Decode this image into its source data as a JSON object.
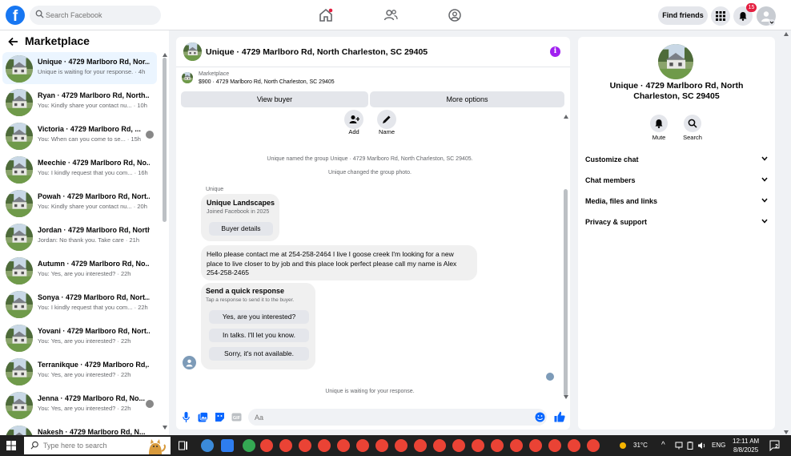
{
  "search": {
    "placeholder": "Search Facebook"
  },
  "topnav": {
    "find_friends": "Find friends",
    "notifications_count": "15"
  },
  "sidebar": {
    "title": "Marketplace",
    "conversations": [
      {
        "name": "Unique · 4729 Marlboro Rd, Nor...",
        "snippet": "Unique is waiting for your response. · 4h"
      },
      {
        "name": "Ryan · 4729 Marlboro Rd, North...",
        "snippet": "You: Kindly share your contact nu... · 10h"
      },
      {
        "name": "Victoria · 4729 Marlboro Rd, ...",
        "snippet": "You: When can you come to se... · 15h"
      },
      {
        "name": "Meechie · 4729 Marlboro Rd, No...",
        "snippet": "You: I kindly request that you com... · 16h"
      },
      {
        "name": "Powah · 4729 Marlboro Rd, Nort...",
        "snippet": "You: Kindly share your contact nu... · 20h"
      },
      {
        "name": "Jordan · 4729 Marlboro Rd, North...",
        "snippet": "Jordan: No thank you. Take care · 21h"
      },
      {
        "name": "Autumn · 4729 Marlboro Rd, No...",
        "snippet": "You: Yes, are you interested? · 22h"
      },
      {
        "name": "Sonya · 4729 Marlboro Rd, Nort...",
        "snippet": "You: I kindly request that you com... · 22h"
      },
      {
        "name": "Yovani · 4729 Marlboro Rd, Nort...",
        "snippet": "You: Yes, are you interested? · 22h"
      },
      {
        "name": "Terranikque · 4729 Marlboro Rd,...",
        "snippet": "You: Yes, are you interested? · 22h"
      },
      {
        "name": "Jenna · 4729 Marlboro Rd, No...",
        "snippet": "You: Yes, are you interested? · 22h"
      },
      {
        "name": "Nakesh · 4729 Marlboro Rd, N...",
        "snippet": ""
      }
    ]
  },
  "chat": {
    "title": "Unique · 4729 Marlboro Rd, North Charleston, SC 29405",
    "marketplace_label": "Marketplace",
    "listing": "$900 · 4729 Marlboro Rd, North Charleston, SC 29405",
    "view_buyer": "View buyer",
    "more_options": "More options",
    "add_label": "Add",
    "name_label": "Name",
    "sys1": "Unique named the group Unique · 4729 Marlboro Rd, North Charleston, SC 29405.",
    "sys2": "Unique changed the group photo.",
    "sender": "Unique",
    "card_title": "Unique Landscapes",
    "card_sub": "Joined Facebook in 2025",
    "buyer_details": "Buyer details",
    "message": "Hello please contact me at 254-258-2464 I live I goose creek I'm looking for a new place to live closer to by job and this place look perfect please call my name is Alex 254-258-2465",
    "quick_title": "Send a quick response",
    "quick_sub": "Tap a response to send it to the buyer.",
    "quick_1": "Yes, are you interested?",
    "quick_2": "In talks. I'll let you know.",
    "quick_3": "Sorry, it's not available.",
    "waiting": "Unique is waiting for your response.",
    "composer_placeholder": "Aa"
  },
  "right": {
    "title": "Unique · 4729 Marlboro Rd, North Charleston, SC 29405",
    "mute": "Mute",
    "search": "Search",
    "sections": [
      "Customize chat",
      "Chat members",
      "Media, files and links",
      "Privacy & support"
    ]
  },
  "taskbar": {
    "search_placeholder": "Type here to search",
    "weather": "31°C",
    "lang": "ENG",
    "time": "12:11 AM",
    "date": "8/8/2025",
    "notif": "2"
  },
  "colors": {
    "brand": "#1877f2",
    "info": "#a020f0",
    "badge": "#e41e3f"
  }
}
